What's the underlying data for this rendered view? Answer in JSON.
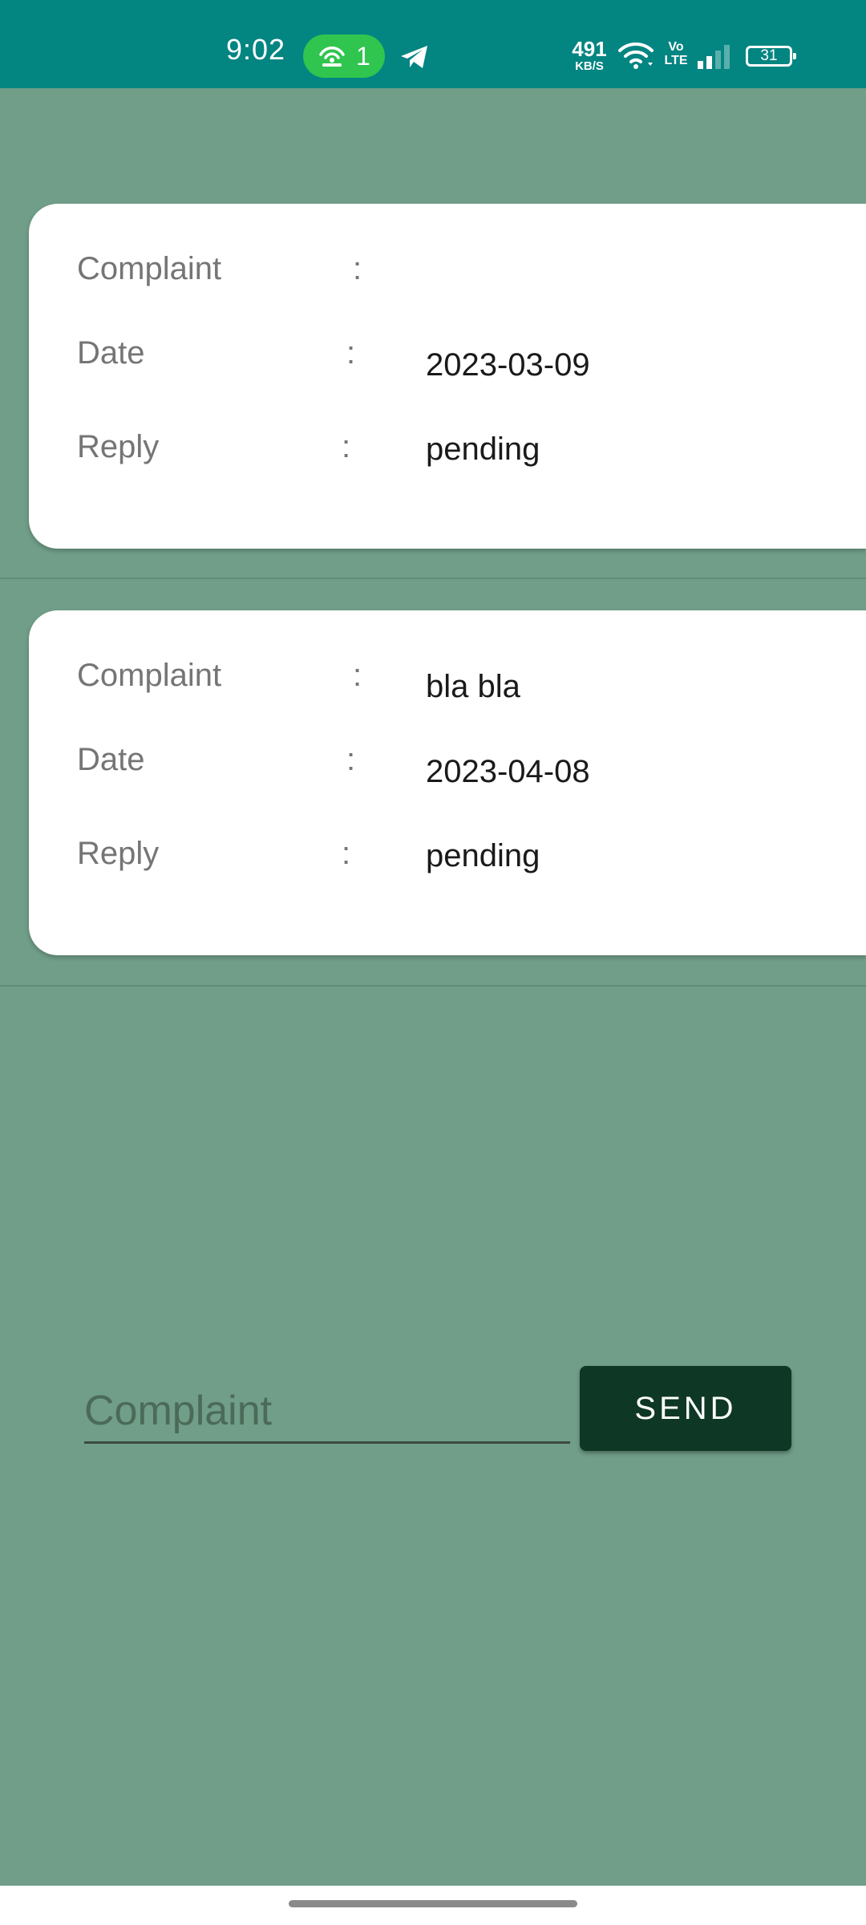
{
  "status_bar": {
    "time": "9:02",
    "hotspot_count": "1",
    "net_speed_value": "491",
    "net_speed_unit": "KB/S",
    "volte_top": "Vo",
    "volte_bottom": "LTE",
    "battery": "31",
    "icons": [
      "hotspot-icon",
      "telegram-icon",
      "wifi-icon",
      "volte-icon",
      "signal-icon",
      "battery-icon"
    ]
  },
  "complaints": [
    {
      "complaint_label": "Complaint",
      "complaint_value": "",
      "date_label": "Date",
      "date_value": "2023-03-09",
      "reply_label": "Reply",
      "reply_value": "pending",
      "separator": ":"
    },
    {
      "complaint_label": "Complaint",
      "complaint_value": "bla bla",
      "date_label": "Date",
      "date_value": "2023-04-08",
      "reply_label": "Reply",
      "reply_value": "pending",
      "separator": ":"
    }
  ],
  "form": {
    "input_placeholder": "Complaint",
    "input_value": "",
    "send_label": "SEND"
  },
  "colors": {
    "status_bar": "#038582",
    "background": "#709e88",
    "card": "#ffffff",
    "send_button": "#0e3825",
    "hotspot_pill": "#2fc54f"
  }
}
